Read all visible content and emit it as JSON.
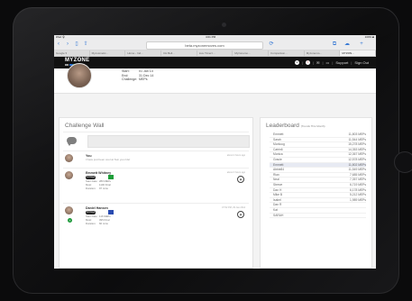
{
  "browser": {
    "status_left": "iPad 令 ",
    "status_time": "4:01 PM",
    "status_right": "100% ■",
    "url": "beta.myzonemoves.com",
    "tabs": [
      "Google ▾",
      "Mycosmetic...",
      "Home - Ind...",
      "CH Bell...",
      "Live Timerz...",
      "Myzonemo...",
      "Comparison...",
      "Myzonemo...",
      "MYZON..."
    ],
    "active_tab": 8
  },
  "site": {
    "logo": "MYZONE",
    "logo_colors": [
      "#9a9a9a",
      "#2c6fd1",
      "#37a33f",
      "#f2c200",
      "#e2231a"
    ],
    "nav_links": {
      "divider": "|",
      "support": "Support",
      "signout": "Sign Out"
    }
  },
  "profile": {
    "start_label": "Start:",
    "start_value": "01 Jan 14",
    "end_label": "End:",
    "end_value": "31 Dec 14",
    "challenge_label": "Challenge:",
    "challenge_value": "MEPs"
  },
  "wall": {
    "title": "Challenge Wall",
    "posts": [
      {
        "name": "You",
        "text": "I have just been cool at Sun you ride!",
        "time": "about 2 hours ago"
      },
      {
        "name": "Emmett Whitney",
        "time": "about 3 hours ago",
        "pill": "14 Days",
        "flag_color": "#1e9e3a",
        "stat1_label": "Start Date:",
        "stat1_value": "280 MEPs",
        "stat2_label": "Most:",
        "stat2_value": "1100 KCal",
        "stat3_label": "Duration:",
        "stat3_value": "97 mins"
      },
      {
        "name": "Daniel Hansen",
        "time": "07:52 PM, 29 Jan 2014",
        "pill": "16 Days",
        "flag_color": "#2a4bb0",
        "stat1_label": "Start Date:",
        "stat1_value": "116 MEPs",
        "stat2_label": "Most:",
        "stat2_value": "395 KCal",
        "stat3_label": "Duration:",
        "stat3_value": "60 mins"
      }
    ]
  },
  "leaderboard": {
    "title": "Leaderboard",
    "subtitle": "(Trends This Month)",
    "rows": [
      {
        "rank": "",
        "name": "Emmett",
        "score": "11,803 MEPs"
      },
      {
        "rank": "",
        "name": "Sarah",
        "score": "11,544 MEPs"
      },
      {
        "rank": "",
        "name": "Montoog",
        "score": "15,278 MEPs"
      },
      {
        "rank": "",
        "name": "Catrin6",
        "score": "14,353 MEPs"
      },
      {
        "rank": "",
        "name": "Monica",
        "score": "12,367 MEPs"
      },
      {
        "rank": "",
        "name": "Gracie",
        "score": "12,578 MEPs"
      },
      {
        "rank": "",
        "name": "Emmett",
        "score": "11,802 MEPs"
      },
      {
        "rank": "",
        "name": "Abbie84",
        "score": "11,549 MEPs"
      },
      {
        "rank": "",
        "name": "Rian",
        "score": "7,685 MEPs"
      },
      {
        "rank": "",
        "name": "Neal",
        "score": "7,357 MEPs"
      },
      {
        "rank": "",
        "name": "Steeve",
        "score": "6,719 MEPs"
      },
      {
        "rank": "",
        "name": "Dan H",
        "score": "6,178 MEPs"
      },
      {
        "rank": "",
        "name": "Mike B",
        "score": "5,212 MEPs"
      },
      {
        "rank": "",
        "name": "Isabel",
        "score": "1,989 MEPs"
      },
      {
        "rank": "",
        "name": "Dan R",
        "score": ""
      },
      {
        "rank": "",
        "name": "Kat",
        "score": ""
      },
      {
        "rank": "",
        "name": "SARAH",
        "score": ""
      }
    ],
    "highlight_index": 6
  }
}
